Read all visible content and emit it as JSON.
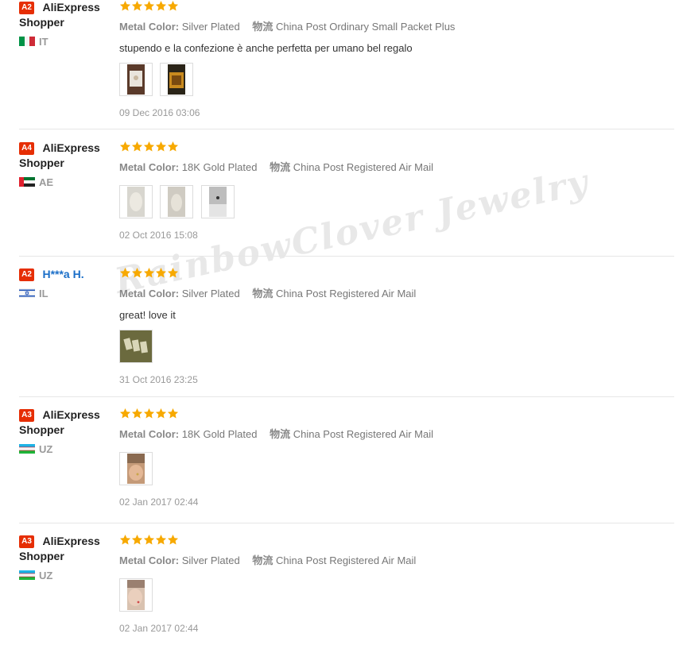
{
  "watermark": "RainbowClover Jewelry",
  "colors": {
    "badge": "#e62e04",
    "star": "#f7a900",
    "link": "#1a6ec8"
  },
  "reviews": [
    {
      "level": "A2",
      "name": "AliExpress",
      "name_line2": "Shopper",
      "name_is_link": false,
      "country": "IT",
      "flag": "italy-flag",
      "stars": 5,
      "metal_label": "Metal Color:",
      "metal_value": "Silver Plated",
      "ship_label": "物流",
      "ship_value": "China Post Ordinary Small Packet Plus",
      "feedback": "stupendo e la confezione è anche perfetta per umano bel regalo",
      "photos": [
        "photo-1",
        "photo-2"
      ],
      "date": "09 Dec 2016 03:06"
    },
    {
      "level": "A4",
      "name": "AliExpress",
      "name_line2": "Shopper",
      "name_is_link": false,
      "country": "AE",
      "flag": "uae-flag",
      "stars": 5,
      "metal_label": "Metal Color:",
      "metal_value": "18K Gold Plated",
      "ship_label": "物流",
      "ship_value": "China Post Registered Air Mail",
      "feedback": "",
      "photos": [
        "photo-1",
        "photo-2",
        "photo-3"
      ],
      "date": "02 Oct 2016 15:08"
    },
    {
      "level": "A2",
      "name": "H***a H.",
      "name_line2": "",
      "name_is_link": true,
      "country": "IL",
      "flag": "israel-flag",
      "stars": 5,
      "metal_label": "Metal Color:",
      "metal_value": "Silver Plated",
      "ship_label": "物流",
      "ship_value": "China Post Registered Air Mail",
      "feedback": "great! love it",
      "photos": [
        "photo-1"
      ],
      "date": "31 Oct 2016 23:25"
    },
    {
      "level": "A3",
      "name": "AliExpress",
      "name_line2": "Shopper",
      "name_is_link": false,
      "country": "UZ",
      "flag": "uzbekistan-flag",
      "stars": 5,
      "metal_label": "Metal Color:",
      "metal_value": "18K Gold Plated",
      "ship_label": "物流",
      "ship_value": "China Post Registered Air Mail",
      "feedback": "",
      "photos": [
        "photo-1"
      ],
      "date": "02 Jan 2017 02:44"
    },
    {
      "level": "A3",
      "name": "AliExpress",
      "name_line2": "Shopper",
      "name_is_link": false,
      "country": "UZ",
      "flag": "uzbekistan-flag",
      "stars": 5,
      "metal_label": "Metal Color:",
      "metal_value": "Silver Plated",
      "ship_label": "物流",
      "ship_value": "China Post Registered Air Mail",
      "feedback": "",
      "photos": [
        "photo-1"
      ],
      "date": "02 Jan 2017 02:44"
    }
  ]
}
